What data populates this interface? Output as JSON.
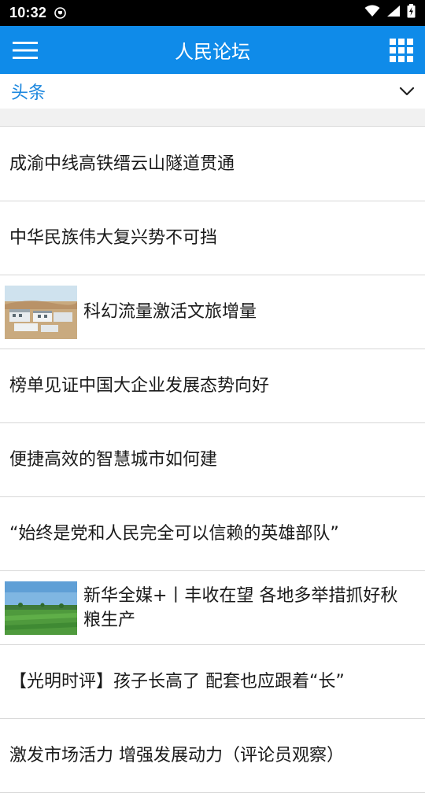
{
  "status_bar": {
    "time": "10:32",
    "icons": [
      "vpn-icon",
      "wifi-icon",
      "cell-signal-icon",
      "battery-icon"
    ]
  },
  "app_bar": {
    "title": "人民论坛",
    "color": "#0f8be9",
    "left_icon": "hamburger-menu-icon",
    "right_icon": "grid-apps-icon"
  },
  "category": {
    "selected": "头条",
    "accent": "#1a86de",
    "dropdown_icon": "chevron-down-icon"
  },
  "news": [
    {
      "title": "成渝中线高铁缙云山隧道贯通",
      "thumb": null
    },
    {
      "title": "中华民族伟大复兴势不可挡",
      "thumb": null
    },
    {
      "title": "科幻流量激活文旅增量",
      "thumb": "desert-buildings"
    },
    {
      "title": "榜单见证中国大企业发展态势向好",
      "thumb": null
    },
    {
      "title": "便捷高效的智慧城市如何建",
      "thumb": null
    },
    {
      "title": "“始终是党和人民完全可以信赖的英雄部队”",
      "thumb": null
    },
    {
      "title": "新华全媒+丨丰收在望 各地多举措抓好秋粮生产",
      "thumb": "crop-field"
    },
    {
      "title": "【光明时评】孩子长高了 配套也应跟着“长”",
      "thumb": null
    },
    {
      "title": "激发市场活力 增强发展动力（评论员观察）",
      "thumb": null
    }
  ]
}
